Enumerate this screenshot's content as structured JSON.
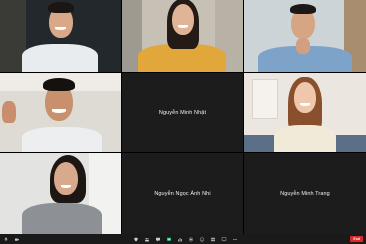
{
  "participants": [
    {
      "name": "",
      "video": true,
      "bg": "#2a2f33"
    },
    {
      "name": "",
      "video": true,
      "bg": "#c9c3b8"
    },
    {
      "name": "",
      "video": true,
      "bg": "#cfd6da"
    },
    {
      "name": "",
      "video": true,
      "bg": "#dcdad6"
    },
    {
      "name": "Nguyễn Minh Nhật",
      "video": false
    },
    {
      "name": "",
      "video": true,
      "bg": "#ece8e2"
    },
    {
      "name": "",
      "video": true,
      "bg": "#e4e4e2"
    },
    {
      "name": "Nguyễn Ngọc Ánh Nhi",
      "video": false
    },
    {
      "name": "Nguyễn Minh Trang",
      "video": false
    }
  ],
  "toolbar": {
    "end_label": "End",
    "left_buttons": [
      "Mute",
      "Stop Video"
    ],
    "center_buttons": [
      "Security",
      "Participants",
      "Chat",
      "Share Screen",
      "Polls",
      "Record",
      "Reactions",
      "Apps",
      "Whiteboard",
      "More"
    ],
    "colors": {
      "end": "#e02828",
      "bar": "#1a1a1a"
    }
  }
}
